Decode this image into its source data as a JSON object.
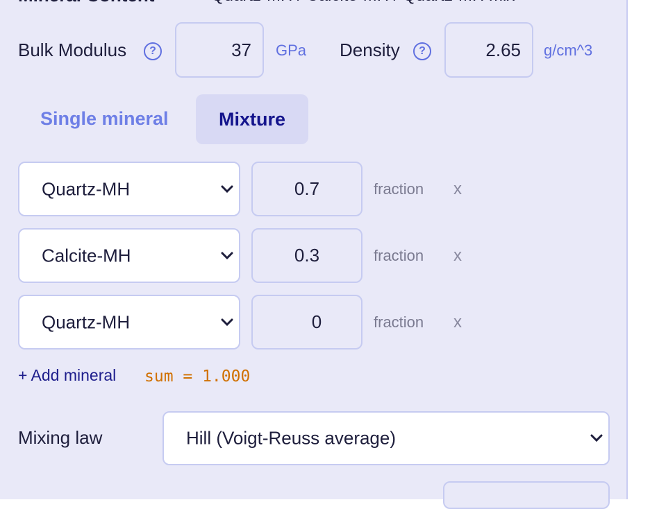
{
  "section": {
    "title": "Mineral Content",
    "summary": "Quartz-MH / Calcite-MH / Quartz-MH mix"
  },
  "bulk_modulus": {
    "label": "Bulk Modulus",
    "value": "37",
    "unit": "GPa"
  },
  "density": {
    "label": "Density",
    "value": "2.65",
    "unit": "g/cm^3"
  },
  "help_glyph": "?",
  "tabs": [
    {
      "label": "Single mineral",
      "active": false
    },
    {
      "label": "Mixture",
      "active": true
    }
  ],
  "minerals": [
    {
      "mineral": "Quartz-MH",
      "fraction": "0.7",
      "fraction_label": "fraction",
      "remove": "x"
    },
    {
      "mineral": "Calcite-MH",
      "fraction": "0.3",
      "fraction_label": "fraction",
      "remove": "x"
    },
    {
      "mineral": "Quartz-MH",
      "fraction": "0",
      "fraction_label": "fraction",
      "remove": "x"
    }
  ],
  "add_mineral_label": "+ Add mineral",
  "sum_text": "sum = 1.000",
  "mixing_law": {
    "label": "Mixing law",
    "value": "Hill (Voigt-Reuss average)"
  },
  "colors": {
    "panel_bg": "#e9e9f8",
    "accent": "#6070e0",
    "active_tab_text": "#14148c",
    "sum_color": "#d07000"
  }
}
